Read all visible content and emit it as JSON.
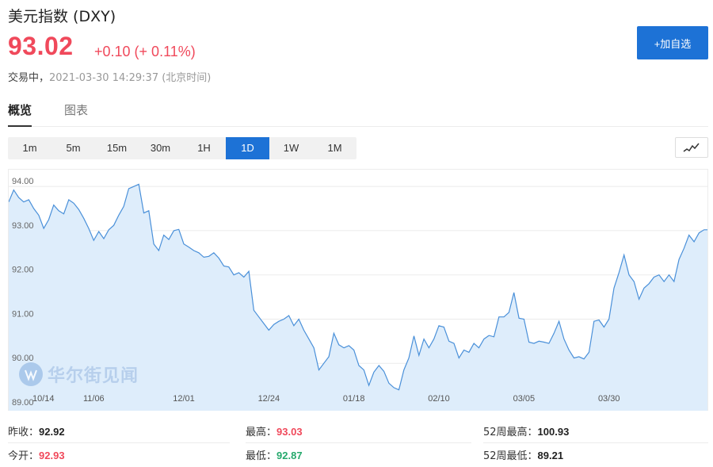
{
  "header": {
    "title": "美元指数 (DXY)",
    "price": "93.02",
    "change": "+0.10 (+ 0.11%)",
    "status_state": "交易中，",
    "status_time": "2021-03-30 14:29:37 (北京时间)",
    "add_button": "+加自选"
  },
  "tabs": [
    {
      "label": "概览",
      "active": true
    },
    {
      "label": "图表",
      "active": false
    }
  ],
  "periods": [
    {
      "label": "1m",
      "active": false
    },
    {
      "label": "5m",
      "active": false
    },
    {
      "label": "15m",
      "active": false
    },
    {
      "label": "30m",
      "active": false
    },
    {
      "label": "1H",
      "active": false
    },
    {
      "label": "1D",
      "active": true
    },
    {
      "label": "1W",
      "active": false
    },
    {
      "label": "1M",
      "active": false
    }
  ],
  "chart_type_icon": "line-chart-icon",
  "watermark": "华尔街见闻",
  "colors": {
    "accent": "#1d72d6",
    "up": "#f0495b",
    "down": "#26a96d",
    "line": "#4a90d9",
    "fill": "#deedfb"
  },
  "chart_data": {
    "type": "area",
    "ylim": [
      89.0,
      94.2
    ],
    "yticks": [
      89.0,
      90.0,
      91.0,
      92.0,
      93.0,
      94.0
    ],
    "ytick_labels": [
      "89.00",
      "90.00",
      "91.00",
      "92.00",
      "93.00",
      "94.00"
    ],
    "xlim": [
      0,
      140
    ],
    "xticks": [
      {
        "label": "10/14",
        "x": 0
      },
      {
        "label": "11/06",
        "x": 17
      },
      {
        "label": "12/01",
        "x": 35
      },
      {
        "label": "12/24",
        "x": 52
      },
      {
        "label": "01/18",
        "x": 69
      },
      {
        "label": "02/10",
        "x": 86
      },
      {
        "label": "03/05",
        "x": 103
      },
      {
        "label": "03/30",
        "x": 120
      }
    ],
    "series": [
      {
        "values": [
          93.65,
          93.92,
          93.75,
          93.65,
          93.7,
          93.5,
          93.35,
          93.05,
          93.25,
          93.58,
          93.45,
          93.38,
          93.7,
          93.62,
          93.48,
          93.28,
          93.05,
          92.78,
          92.98,
          92.82,
          93.02,
          93.12,
          93.35,
          93.55,
          93.95,
          94.0,
          94.05,
          93.4,
          93.45,
          92.7,
          92.55,
          92.9,
          92.8,
          93.0,
          93.03,
          92.7,
          92.63,
          92.55,
          92.5,
          92.4,
          92.42,
          92.5,
          92.38,
          92.2,
          92.18,
          92.0,
          92.05,
          91.95,
          92.08,
          91.2,
          91.05,
          90.9,
          90.75,
          90.88,
          90.95,
          91.0,
          91.08,
          90.85,
          91.0,
          90.75,
          90.55,
          90.35,
          89.85,
          90.0,
          90.15,
          90.68,
          90.42,
          90.35,
          90.4,
          90.3,
          89.95,
          89.85,
          89.5,
          89.8,
          89.95,
          89.82,
          89.55,
          89.45,
          89.4,
          89.85,
          90.12,
          90.62,
          90.18,
          90.55,
          90.35,
          90.55,
          90.85,
          90.82,
          90.5,
          90.45,
          90.12,
          90.3,
          90.25,
          90.45,
          90.35,
          90.55,
          90.63,
          90.6,
          91.05,
          91.05,
          91.15,
          91.6,
          91.02,
          91.0,
          90.48,
          90.45,
          90.5,
          90.48,
          90.45,
          90.68,
          90.95,
          90.55,
          90.3,
          90.12,
          90.15,
          90.1,
          90.25,
          90.95,
          90.98,
          90.82,
          91.0,
          91.7,
          92.05,
          92.45,
          92.0,
          91.85,
          91.45,
          91.7,
          91.8,
          91.95,
          92.0,
          91.85,
          92.0,
          91.85,
          92.35,
          92.6,
          92.9,
          92.75,
          92.95,
          93.02,
          93.02
        ]
      }
    ]
  },
  "stats": {
    "rows": [
      [
        {
          "label": "昨收：",
          "value": "92.92",
          "color": "dark"
        },
        {
          "label": "最高：",
          "value": "93.03",
          "color": "red"
        },
        {
          "label": "52周最高：",
          "value": "100.93",
          "color": "dark"
        }
      ],
      [
        {
          "label": "今开：",
          "value": "92.93",
          "color": "red"
        },
        {
          "label": "最低：",
          "value": "92.87",
          "color": "green"
        },
        {
          "label": "52周最低：",
          "value": "89.21",
          "color": "dark"
        }
      ]
    ]
  }
}
